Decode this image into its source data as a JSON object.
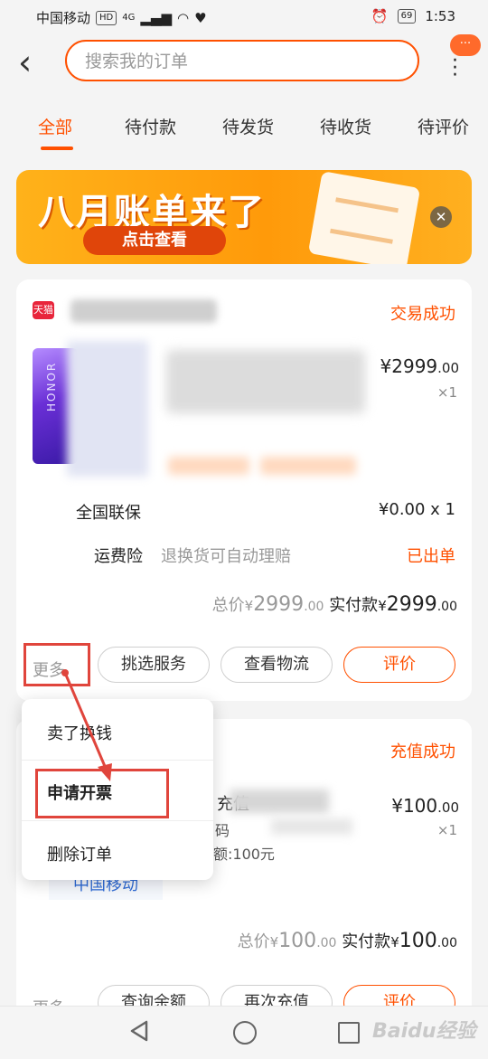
{
  "status_bar": {
    "carrier": "中国移动",
    "hd": "HD",
    "net": "4G",
    "battery": "69",
    "time": "1:53"
  },
  "search": {
    "placeholder": "搜索我的订单",
    "msg_badge": "···"
  },
  "tabs": [
    "全部",
    "待付款",
    "待发货",
    "待收货",
    "待评价"
  ],
  "banner": {
    "title": "八月账单来了",
    "button": "点击查看"
  },
  "order1": {
    "shop_badge": "天猫",
    "status": "交易成功",
    "brand_text": "HONOR",
    "price": "¥2999",
    "price_cents": ".00",
    "qty": "×1",
    "service_label": "全国联保",
    "service_price": "¥0.00 x 1",
    "insurance_label": "运费险",
    "insurance_desc": "退换货可自动理赔",
    "insurance_status": "已出单",
    "total_label": "总价",
    "total_cur": "¥",
    "total_value": "2999",
    "total_cents": ".00",
    "paid_label": "实付款",
    "paid_cur": "¥",
    "paid_value": "2999",
    "paid_cents": ".00",
    "more": "更多",
    "buttons": [
      "挑选服务",
      "查看物流",
      "评价"
    ]
  },
  "popup_menu": [
    "卖了换钱",
    "申请开票",
    "删除订单"
  ],
  "order2": {
    "status": "充值成功",
    "title_frag": "充值",
    "line1": "码",
    "line2": "额:100元",
    "carrier": "中国移动",
    "price": "¥100",
    "price_cents": ".00",
    "qty": "×1",
    "total_label": "总价",
    "total_cur": "¥",
    "total_value": "100",
    "total_cents": ".00",
    "paid_label": "实付款",
    "paid_cur": "¥",
    "paid_value": "100",
    "paid_cents": ".00",
    "more": "更多",
    "buttons": [
      "查询余额",
      "再次充值",
      "评价"
    ]
  },
  "watermark": "Baidu经验",
  "colors": {
    "accent": "#ff5000",
    "highlight_box": "#e0453c"
  }
}
